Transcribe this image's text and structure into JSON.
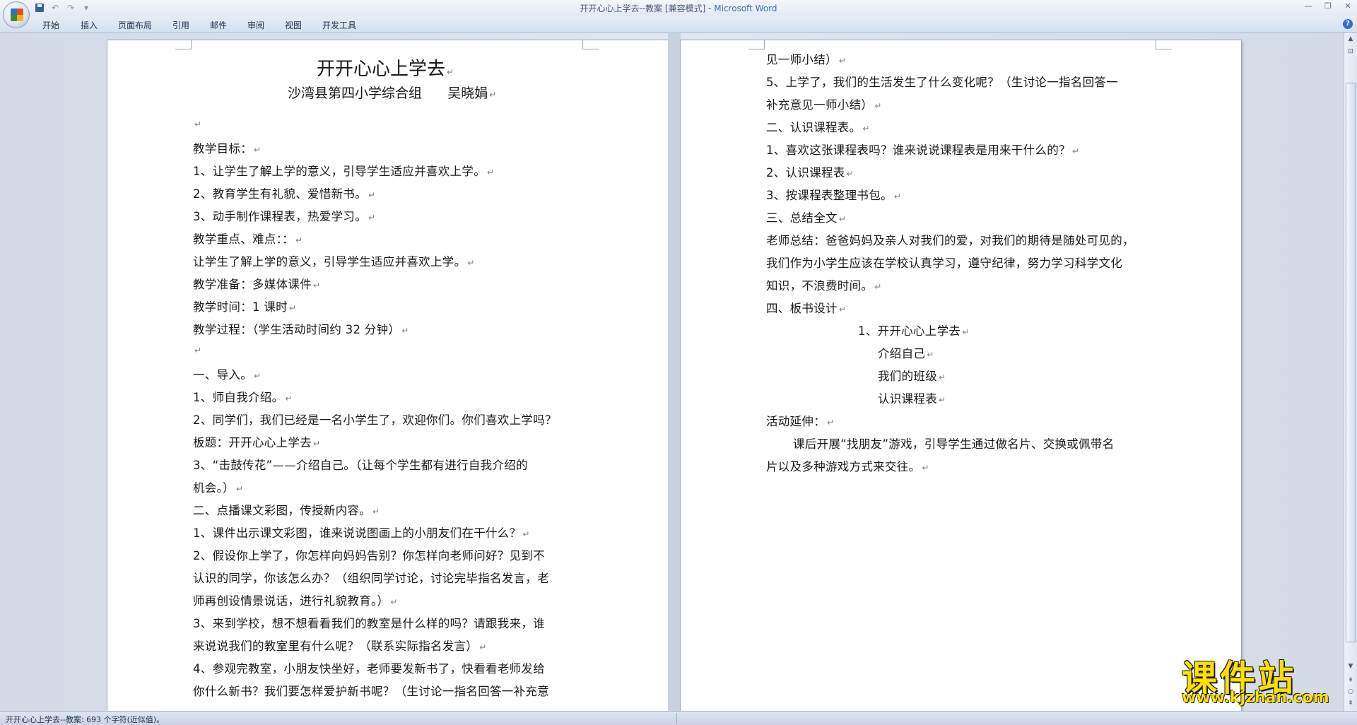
{
  "window": {
    "title_doc": "开开心心上学去--教案 [兼容模式] - ",
    "title_app": "Microsoft Word"
  },
  "ribbon": {
    "tabs": [
      "开始",
      "插入",
      "页面布局",
      "引用",
      "邮件",
      "审阅",
      "视图",
      "开发工具"
    ]
  },
  "page_left": {
    "title": "开开心心上学去",
    "subtitle": "沙湾县第四小学综合组      吴晓娟",
    "lines": [
      "",
      "教学目标：",
      "1、让学生了解上学的意义，引导学生适应并喜欢上学。",
      "2、教育学生有礼貌、爱惜新书。",
      "3、动手制作课程表，热爱学习。",
      "教学重点、难点：：",
      "让学生了解上学的意义，引导学生适应并喜欢上学。",
      "教学准备：多媒体课件",
      "教学时间：1 课时",
      "教学过程：（学生活动时间约 32 分钟）",
      "",
      "一、导入。",
      "1、师自我介绍。",
      "2、同学们，我们已经是一名小学生了，欢迎你们。你们喜欢上学吗？",
      "板题：开开心心上学去",
      "3、“击鼓传花”——介绍自己。（让每个学生都有进行自我介绍的",
      "机会。）",
      "二、点播课文彩图，传授新内容。",
      "1、课件出示课文彩图，谁来说说图画上的小朋友们在干什么？",
      "2、假设你上学了，你怎样向妈妈告别？你怎样向老师问好？见到不",
      "认识的同学，你该怎么办？（组织同学讨论，讨论完毕指名发言，老",
      "师再创设情景说话，进行礼貌教育。）",
      "3、来到学校，想不想看看我们的教室是什么样的吗？请跟我来，谁",
      "来说说我们的教室里有什么呢？（联系实际指名发言）",
      "4、参观完教室，小朋友快坐好，老师要发新书了，快看看老师发给",
      "你什么新书？我们要怎样爱护新书呢？（生讨论一指名回答一补充意"
    ],
    "marks": [
      true,
      true,
      true,
      true,
      true,
      true,
      true,
      true,
      true,
      true,
      true,
      true,
      true,
      false,
      true,
      false,
      true,
      true,
      true,
      false,
      false,
      true,
      false,
      true,
      false,
      false
    ]
  },
  "page_right": {
    "lines": [
      {
        "t": "见一师小结）",
        "m": true,
        "i": 0
      },
      {
        "t": "5、上学了，我们的生活发生了什么变化呢？（生讨论一指名回答一",
        "m": false,
        "i": 0
      },
      {
        "t": "补充意见一师小结）",
        "m": true,
        "i": 0
      },
      {
        "t": "二、认识课程表。",
        "m": true,
        "i": 0
      },
      {
        "t": "1、喜欢这张课程表吗？谁来说说课程表是用来干什么的？",
        "m": true,
        "i": 0
      },
      {
        "t": "2、认识课程表",
        "m": true,
        "i": 0
      },
      {
        "t": "3、按课程表整理书包。",
        "m": true,
        "i": 0
      },
      {
        "t": "三、总结全文",
        "m": true,
        "i": 0
      },
      {
        "t": "老师总结：爸爸妈妈及亲人对我们的爱，对我们的期待是随处可见的，",
        "m": false,
        "i": 0
      },
      {
        "t": "我们作为小学生应该在学校认真学习，遵守纪律，努力学习科学文化",
        "m": false,
        "i": 0
      },
      {
        "t": "知识，不浪费时间。",
        "m": true,
        "i": 0
      },
      {
        "t": "四、板书设计",
        "m": true,
        "i": 0
      },
      {
        "t": "1、开开心心上学去",
        "m": true,
        "i": 130
      },
      {
        "t": "介绍自己",
        "m": true,
        "i": 158
      },
      {
        "t": "我们的班级",
        "m": true,
        "i": 158
      },
      {
        "t": "认识课程表",
        "m": true,
        "i": 158
      },
      {
        "t": "活动延伸：",
        "m": true,
        "i": 0
      },
      {
        "t": "课后开展“找朋友”游戏，引导学生通过做名片、交换或佩带名",
        "m": false,
        "i": 38
      },
      {
        "t": "片以及多种游戏方式来交往。",
        "m": true,
        "i": 0
      }
    ]
  },
  "status": {
    "text": "开开心心上学去--教案: 693 个字符(近似值)。"
  },
  "watermark": {
    "main": "课件站",
    "url": "www.kjzhan.com"
  },
  "icons": {
    "office_button": "office-logo-icon",
    "save": "save-icon",
    "undo": "undo-icon",
    "redo": "redo-icon",
    "customize": "customize-qat-icon",
    "paragraph_mark": "↵",
    "help": "help-icon"
  },
  "colors": {
    "title_app": "#3a6cbb",
    "ribbon_text": "#20324f",
    "watermark": "#ffe000"
  }
}
